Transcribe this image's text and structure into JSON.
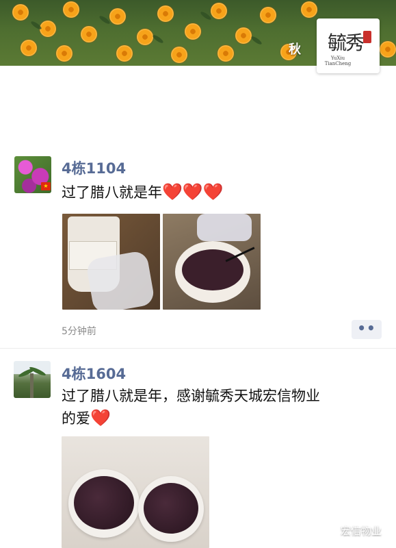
{
  "cover": {
    "caption": "秋",
    "logo": {
      "cn": "毓秀",
      "en": "YuXiu TianCheng"
    }
  },
  "posts": [
    {
      "author": "4栋1104",
      "text": "过了腊八就是年",
      "hearts": "❤️❤️❤️",
      "time": "5分钟前",
      "more": "••"
    },
    {
      "author": "4栋1604",
      "text_line1": "过了腊八就是年，感谢毓秀天城宏信物业",
      "text_line2": "的爱",
      "heart": "❤️"
    }
  ],
  "watermark": {
    "text": "宏信物业"
  }
}
